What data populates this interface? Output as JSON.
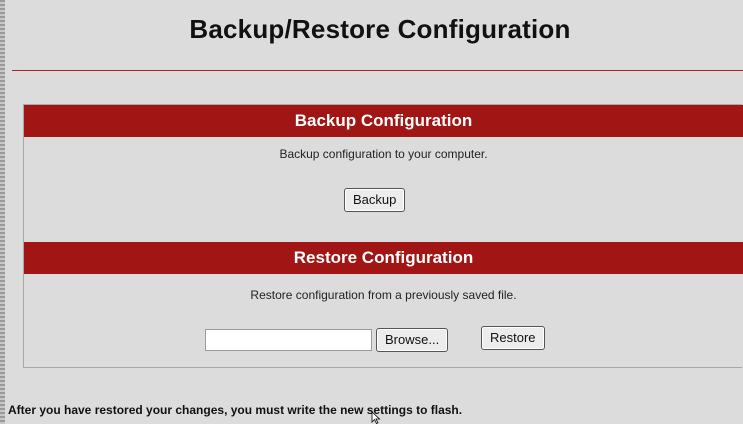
{
  "page": {
    "title": "Backup/Restore Configuration"
  },
  "backup": {
    "header": "Backup Configuration",
    "description": "Backup configuration to your computer.",
    "button_label": "Backup"
  },
  "restore": {
    "header": "Restore Configuration",
    "description": "Restore configuration from a previously saved file.",
    "file_value": "",
    "browse_label": "Browse...",
    "button_label": "Restore"
  },
  "footer": {
    "note": "After you have restored your changes, you must write the new settings to flash."
  },
  "colors": {
    "header_bg": "#a11515",
    "rule": "#b32020",
    "page_bg": "#dcdcdc"
  },
  "icons": {
    "cursor": "mouse-pointer-icon"
  }
}
